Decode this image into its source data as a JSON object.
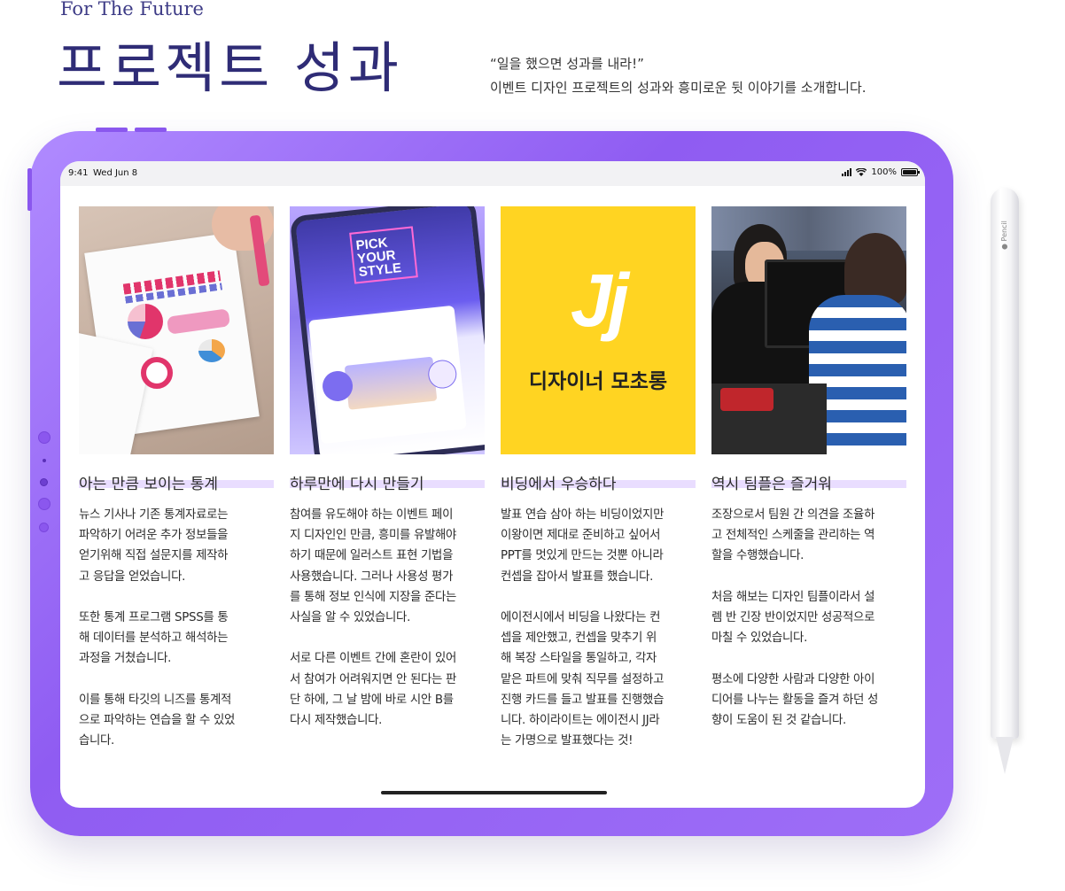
{
  "header": {
    "eyebrow": "For The Future",
    "title": "프로젝트 성과",
    "quote": "“일을 했으면 성과를 내라!”",
    "description": "이벤트 디자인 프로젝트의 성과와 흥미로운 뒷 이야기를 소개합니다."
  },
  "status_bar": {
    "time": "9:41",
    "date": "Wed Jun 8",
    "battery": "100%",
    "battery_level": 1.0
  },
  "columns": [
    {
      "title": "아는 만큼 보이는 통계",
      "body": "뉴스 기사나 기존 통계자료로는\n파악하기 어려운 추가 정보들을\n얻기위해 직접 설문지를 제작하\n고 응답을 얻었습니다.\n\n또한 통계 프로그램 SPSS를 통\n해 데이터를 분석하고 해석하는\n과정을 거쳤습니다.\n\n이를 통해 타깃의 니즈를 통계적\n으로 파악하는 연습을 할 수 있었\n습니다."
    },
    {
      "title": "하루만에 다시 만들기",
      "body": "참여를 유도해야 하는 이벤트 페이\n지 디자인인 만큼, 흥미를 유발해야\n하기 때문에 일러스트 표현 기법을\n사용했습니다. 그러나 사용성 평가\n를 통해 정보 인식에 지장을 준다는\n사실을 알 수 있었습니다.\n\n서로 다른 이벤트 간에 혼란이 있어\n서 참여가 어려워지면 안 된다는 판\n단 하에, 그 날 밤에 바로 시안 B를\n다시 제작했습니다.",
      "image_text": {
        "logo_line1": "PICK",
        "logo_line2": "YOUR",
        "logo_line3": "STYLE"
      }
    },
    {
      "title": "비딩에서 우승하다",
      "body": "발표 연습 삼아 하는 비딩이었지만\n이왕이면 제대로 준비하고 싶어서\nPPT를 멋있게 만드는 것뿐 아니라\n컨셉을 잡아서 발표를 했습니다.\n\n에이전시에서 비딩을 나왔다는 컨\n셉을 제안했고, 컨셉을 맞추기 위\n해 복장 스타일을 통일하고, 각자\n맡은 파트에 맞춰 직무를 설정하고\n진행 카드를 들고 발표를 진행했습\n니다. 하이라이트는 에이전시 JJ라\n는 가명으로 발표했다는 것!",
      "image_text": {
        "logo": "Jj",
        "name": "디자이너 모초롱"
      }
    },
    {
      "title": "역시 팀플은 즐거워",
      "body": "조장으로서 팀원 간 의견을 조율하\n고 전체적인 스케줄을 관리하는 역\n할을 수행했습니다.\n\n처음 해보는 디자인 팀플이라서 설\n렘 반 긴장 반이었지만 성공적으로\n마칠 수 있었습니다.\n\n평소에 다양한 사람과 다양한 아이\n디어를 나누는 활동을 즐겨 하던 성\n향이 도움이 된 것 같습니다."
    }
  ],
  "pencil_label": "Pencil",
  "colors": {
    "title": "#2f2c76",
    "tablet_frame": "#9e6ef7",
    "highlight": "#e9ddff",
    "jj_background": "#ffd422"
  }
}
